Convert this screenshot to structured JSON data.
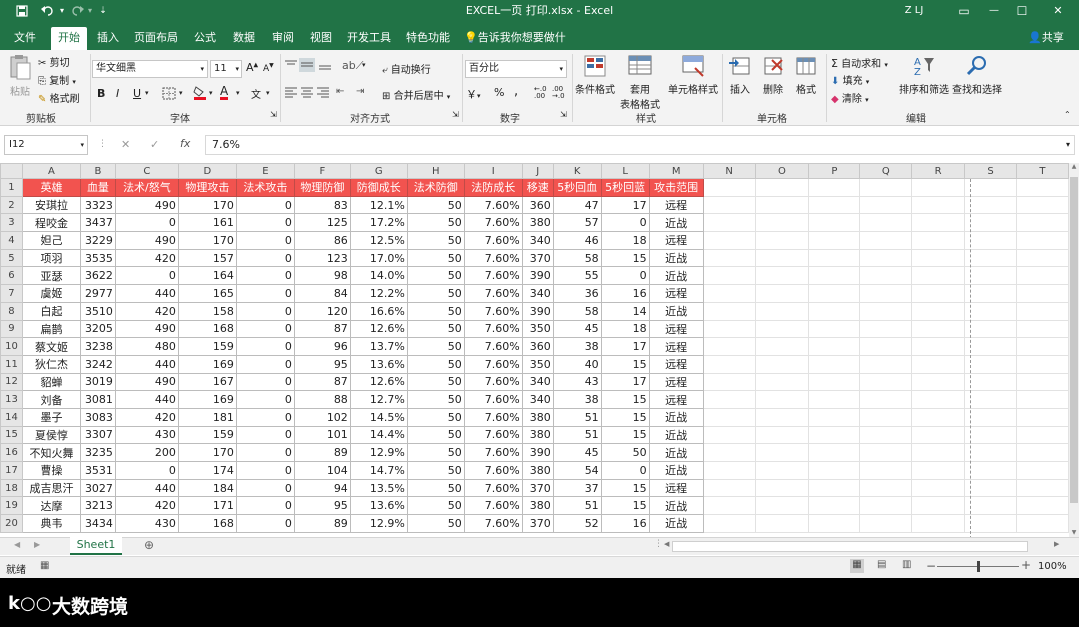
{
  "window": {
    "title": "EXCEL一页 打印.xlsx - Excel",
    "user": "Z LJ",
    "controls": {
      "restore": "▭",
      "minimize": "—",
      "maximize": "☐",
      "close": "✕"
    }
  },
  "ribbon_tabs": [
    "文件",
    "开始",
    "插入",
    "页面布局",
    "公式",
    "数据",
    "审阅",
    "视图",
    "开发工具",
    "特色功能"
  ],
  "tell_me": "告诉我你想要做什么",
  "share": "共享",
  "ribbon": {
    "clipboard": {
      "label": "剪贴板",
      "paste": "粘贴",
      "cut": "剪切",
      "copy": "复制",
      "format_painter": "格式刷"
    },
    "font": {
      "label": "字体",
      "font_name": "华文细黑",
      "font_size": "11",
      "grow": "A",
      "shrink": "A",
      "bold": "B",
      "italic": "I",
      "underline": "U",
      "wen": "文"
    },
    "alignment": {
      "label": "对齐方式",
      "wrap": "自动换行",
      "merge": "合并后居中"
    },
    "number": {
      "label": "数字",
      "format": "百分比",
      "currency": "￥",
      "percent": "%",
      "comma": ","
    },
    "styles": {
      "label": "样式",
      "conditional": "条件格式",
      "table_l1": "套用",
      "table_l2": "表格格式",
      "cell_styles": "单元格样式"
    },
    "cells": {
      "label": "单元格",
      "insert": "插入",
      "delete": "删除",
      "format": "格式"
    },
    "editing": {
      "label": "编辑",
      "autosum": "自动求和",
      "fill": "填充",
      "clear": "清除",
      "sort": "排序和筛选",
      "find": "查找和选择"
    }
  },
  "formula_bar": {
    "name_box": "I12",
    "formula": "7.6%",
    "cancel": "✕",
    "enter": "✓",
    "fx": "fx"
  },
  "columns": [
    "A",
    "B",
    "C",
    "D",
    "E",
    "F",
    "G",
    "H",
    "I",
    "J",
    "K",
    "L",
    "M",
    "N",
    "O",
    "P",
    "Q",
    "R",
    "S",
    "T"
  ],
  "header_row": [
    "英雄",
    "血量",
    "法术/怒气",
    "物理攻击",
    "法术攻击",
    "物理防御",
    "防御成长",
    "法术防御",
    "法防成长",
    "移速",
    "5秒回血",
    "5秒回蓝",
    "攻击范围"
  ],
  "rows": [
    [
      "安琪拉",
      "3323",
      "490",
      "170",
      "0",
      "83",
      "12.1%",
      "50",
      "7.60%",
      "360",
      "47",
      "17",
      "远程"
    ],
    [
      "程咬金",
      "3437",
      "0",
      "161",
      "0",
      "125",
      "17.2%",
      "50",
      "7.60%",
      "380",
      "57",
      "0",
      "近战"
    ],
    [
      "妲己",
      "3229",
      "490",
      "170",
      "0",
      "86",
      "12.5%",
      "50",
      "7.60%",
      "340",
      "46",
      "18",
      "远程"
    ],
    [
      "项羽",
      "3535",
      "420",
      "157",
      "0",
      "123",
      "17.0%",
      "50",
      "7.60%",
      "370",
      "58",
      "15",
      "近战"
    ],
    [
      "亚瑟",
      "3622",
      "0",
      "164",
      "0",
      "98",
      "14.0%",
      "50",
      "7.60%",
      "390",
      "55",
      "0",
      "近战"
    ],
    [
      "虞姬",
      "2977",
      "440",
      "165",
      "0",
      "84",
      "12.2%",
      "50",
      "7.60%",
      "340",
      "36",
      "16",
      "远程"
    ],
    [
      "白起",
      "3510",
      "420",
      "158",
      "0",
      "120",
      "16.6%",
      "50",
      "7.60%",
      "390",
      "58",
      "14",
      "近战"
    ],
    [
      "扁鹊",
      "3205",
      "490",
      "168",
      "0",
      "87",
      "12.6%",
      "50",
      "7.60%",
      "350",
      "45",
      "18",
      "远程"
    ],
    [
      "蔡文姬",
      "3238",
      "480",
      "159",
      "0",
      "96",
      "13.7%",
      "50",
      "7.60%",
      "360",
      "38",
      "17",
      "远程"
    ],
    [
      "狄仁杰",
      "3242",
      "440",
      "169",
      "0",
      "95",
      "13.6%",
      "50",
      "7.60%",
      "350",
      "40",
      "15",
      "远程"
    ],
    [
      "貂蝉",
      "3019",
      "490",
      "167",
      "0",
      "87",
      "12.6%",
      "50",
      "7.60%",
      "340",
      "43",
      "17",
      "远程"
    ],
    [
      "刘备",
      "3081",
      "440",
      "169",
      "0",
      "88",
      "12.7%",
      "50",
      "7.60%",
      "340",
      "38",
      "15",
      "远程"
    ],
    [
      "墨子",
      "3083",
      "420",
      "181",
      "0",
      "102",
      "14.5%",
      "50",
      "7.60%",
      "380",
      "51",
      "15",
      "近战"
    ],
    [
      "夏侯惇",
      "3307",
      "430",
      "159",
      "0",
      "101",
      "14.4%",
      "50",
      "7.60%",
      "380",
      "51",
      "15",
      "近战"
    ],
    [
      "不知火舞",
      "3235",
      "200",
      "170",
      "0",
      "89",
      "12.9%",
      "50",
      "7.60%",
      "390",
      "45",
      "50",
      "近战"
    ],
    [
      "曹操",
      "3531",
      "0",
      "174",
      "0",
      "104",
      "14.7%",
      "50",
      "7.60%",
      "380",
      "54",
      "0",
      "近战"
    ],
    [
      "成吉思汗",
      "3027",
      "440",
      "184",
      "0",
      "94",
      "13.5%",
      "50",
      "7.60%",
      "370",
      "37",
      "15",
      "远程"
    ],
    [
      "达摩",
      "3213",
      "420",
      "171",
      "0",
      "95",
      "13.6%",
      "50",
      "7.60%",
      "380",
      "51",
      "15",
      "近战"
    ],
    [
      "典韦",
      "3434",
      "430",
      "168",
      "0",
      "89",
      "12.9%",
      "50",
      "7.60%",
      "370",
      "52",
      "16",
      "近战"
    ]
  ],
  "sheet_tabs": [
    "Sheet1"
  ],
  "add_sheet": "⊕",
  "status": {
    "ready": "就绪",
    "zoom": "100%",
    "minus": "−",
    "plus": "+"
  },
  "footer": {
    "brand": "大数跨境",
    "logo": "k"
  }
}
